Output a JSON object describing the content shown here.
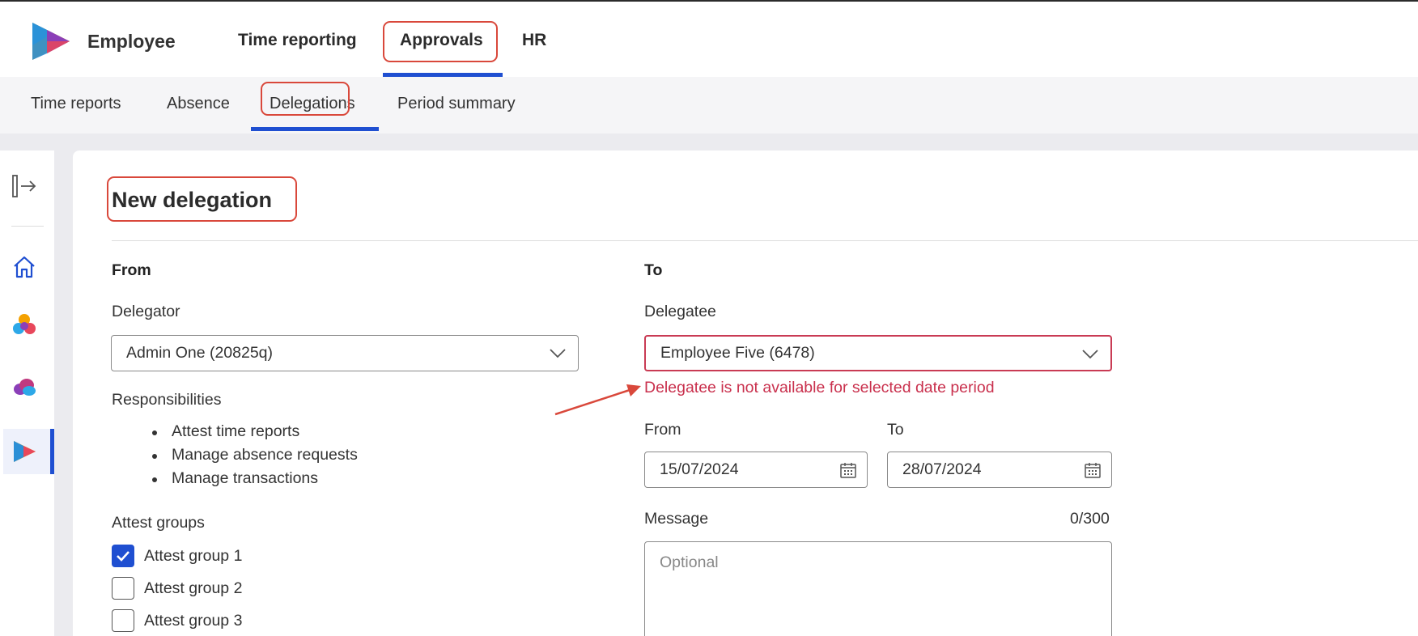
{
  "app": {
    "title": "Employee"
  },
  "top_nav": {
    "items": [
      {
        "label": "Time reporting"
      },
      {
        "label": "Approvals",
        "active": true
      },
      {
        "label": "HR"
      }
    ]
  },
  "sub_nav": {
    "items": [
      {
        "label": "Time reports"
      },
      {
        "label": "Absence"
      },
      {
        "label": "Delegations",
        "active": true
      },
      {
        "label": "Period summary"
      }
    ]
  },
  "left_rail": {
    "icons": [
      "expand-icon",
      "home-icon",
      "colorful-app-icon",
      "cloud-app-icon",
      "play-logo-icon"
    ]
  },
  "page": {
    "title": "New delegation"
  },
  "from_section": {
    "heading": "From",
    "delegator_label": "Delegator",
    "delegator_value": "Admin One (20825q)",
    "responsibilities_label": "Responsibilities",
    "responsibilities": [
      "Attest time reports",
      "Manage absence requests",
      "Manage transactions"
    ],
    "attest_groups_label": "Attest groups",
    "attest_groups": [
      {
        "label": "Attest group 1",
        "checked": true
      },
      {
        "label": "Attest group 2",
        "checked": false
      },
      {
        "label": "Attest group 3",
        "checked": false
      }
    ]
  },
  "to_section": {
    "heading": "To",
    "delegatee_label": "Delegatee",
    "delegatee_value": "Employee Five (6478)",
    "delegatee_error": "Delegatee is not available for selected date period",
    "from_label": "From",
    "from_date": "15/07/2024",
    "to_label": "To",
    "to_date": "28/07/2024",
    "message_label": "Message",
    "message_counter": "0/300",
    "message_placeholder": "Optional"
  },
  "colors": {
    "accent": "#1f4fd1",
    "error": "#c9304d",
    "annotation": "#d9483b"
  }
}
